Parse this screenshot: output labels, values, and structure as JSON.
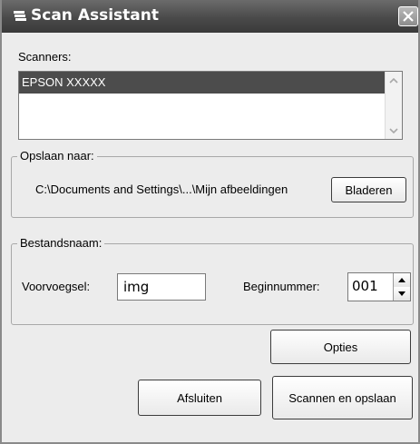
{
  "window": {
    "title": "Scan Assistant"
  },
  "scanners": {
    "label": "Scanners:",
    "items": [
      "EPSON XXXXX"
    ]
  },
  "save_to": {
    "legend": "Opslaan naar:",
    "path": "C:\\Documents and Settings\\...\\Mijn afbeeldingen",
    "browse_label": "Bladeren"
  },
  "filename": {
    "legend": "Bestandsnaam:",
    "prefix_label": "Voorvoegsel:",
    "prefix_value": "img",
    "start_label": "Beginnummer:",
    "start_value": "001"
  },
  "buttons": {
    "options": "Opties",
    "close": "Afsluiten",
    "scan_save": "Scannen en opslaan"
  }
}
